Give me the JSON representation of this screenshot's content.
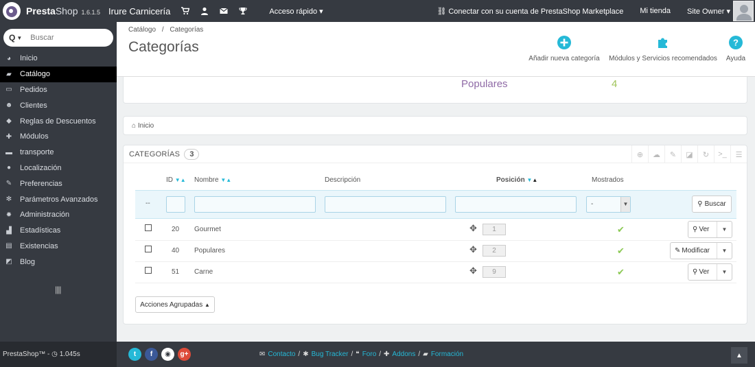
{
  "topbar": {
    "brand_bold": "Presta",
    "brand_light": "Shop",
    "version": "1.6.1.5",
    "store_name": "Irure Carnicería",
    "quick_access": "Acceso rápido",
    "marketplace": "Conectar con su cuenta de PrestaShop Marketplace",
    "my_store": "Mi tienda",
    "user": "Site Owner"
  },
  "sidebar": {
    "search_placeholder": "Buscar",
    "items": [
      {
        "label": "Inicio",
        "icon": "dashboard-icon"
      },
      {
        "label": "Catálogo",
        "icon": "book-icon"
      },
      {
        "label": "Pedidos",
        "icon": "credit-card-icon"
      },
      {
        "label": "Clientes",
        "icon": "users-icon"
      },
      {
        "label": "Reglas de Descuentos",
        "icon": "tag-icon"
      },
      {
        "label": "Módulos",
        "icon": "puzzle-icon"
      },
      {
        "label": "transporte",
        "icon": "truck-icon"
      },
      {
        "label": "Localización",
        "icon": "globe-icon"
      },
      {
        "label": "Preferencias",
        "icon": "wrench-icon"
      },
      {
        "label": "Parámetros Avanzados",
        "icon": "cogs-icon"
      },
      {
        "label": "Administración",
        "icon": "gear-icon"
      },
      {
        "label": "Estadísticas",
        "icon": "bar-chart-icon"
      },
      {
        "label": "Existencias",
        "icon": "stock-icon"
      },
      {
        "label": "Blog",
        "icon": "edit-icon"
      }
    ]
  },
  "header": {
    "breadcrumb_1": "Catálogo",
    "breadcrumb_sep": "/",
    "breadcrumb_2": "Categorías",
    "title": "Categorías",
    "add_label": "Añadir nueva categoría",
    "modules_label": "Módulos y Servicios recomendados",
    "help_label": "Ayuda"
  },
  "kpi": {
    "label": "Populares",
    "value": "4"
  },
  "breadcrumb_panel": {
    "label": "Inicio"
  },
  "list": {
    "title": "Categorías",
    "count": "3",
    "columns": {
      "id": "ID",
      "name": "Nombre",
      "description": "Descripción",
      "position": "Posición",
      "shown": "Mostrados"
    },
    "filter_dash": "--",
    "filter_select": "-",
    "search_button": "Buscar",
    "rows": [
      {
        "id": "20",
        "name": "Gourmet",
        "position": "1",
        "action": "Ver"
      },
      {
        "id": "40",
        "name": "Populares",
        "position": "2",
        "action": "Modificar"
      },
      {
        "id": "51",
        "name": "Carne",
        "position": "9",
        "action": "Ver"
      }
    ],
    "bulk_label": "Acciones Agrupadas"
  },
  "footer": {
    "brand": "PrestaShop™",
    "sep": "-",
    "time": "1.045s",
    "contact": "Contacto",
    "bug_tracker": "Bug Tracker",
    "forum": "Foro",
    "addons": "Addons",
    "training": "Formación"
  },
  "colors": {
    "topbar_bg": "#363a41",
    "accent_blue": "#25b9d7",
    "kpi_purple": "#8f6aa6",
    "kpi_green": "#a0c45a",
    "check_green": "#8bc954"
  }
}
